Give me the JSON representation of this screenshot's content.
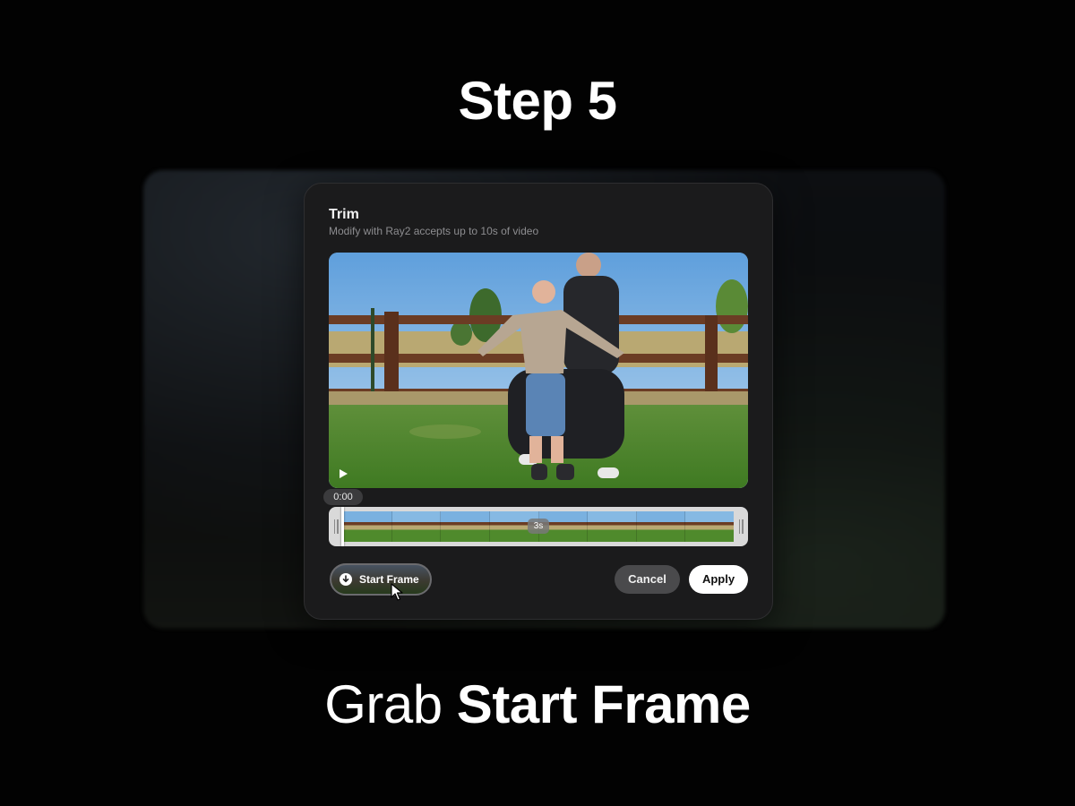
{
  "header": {
    "step_title": "Step 5"
  },
  "dialog": {
    "title": "Trim",
    "subtitle": "Modify with Ray2 accepts up to 10s of video",
    "player": {
      "current_time": "0:00",
      "play_icon": "play-icon"
    },
    "timeline": {
      "duration_badge": "3s"
    },
    "start_frame_button": {
      "label": "Start Frame",
      "icon": "download-icon"
    },
    "cancel_label": "Cancel",
    "apply_label": "Apply"
  },
  "caption": {
    "light": "Grab",
    "bold": "Start Frame"
  }
}
